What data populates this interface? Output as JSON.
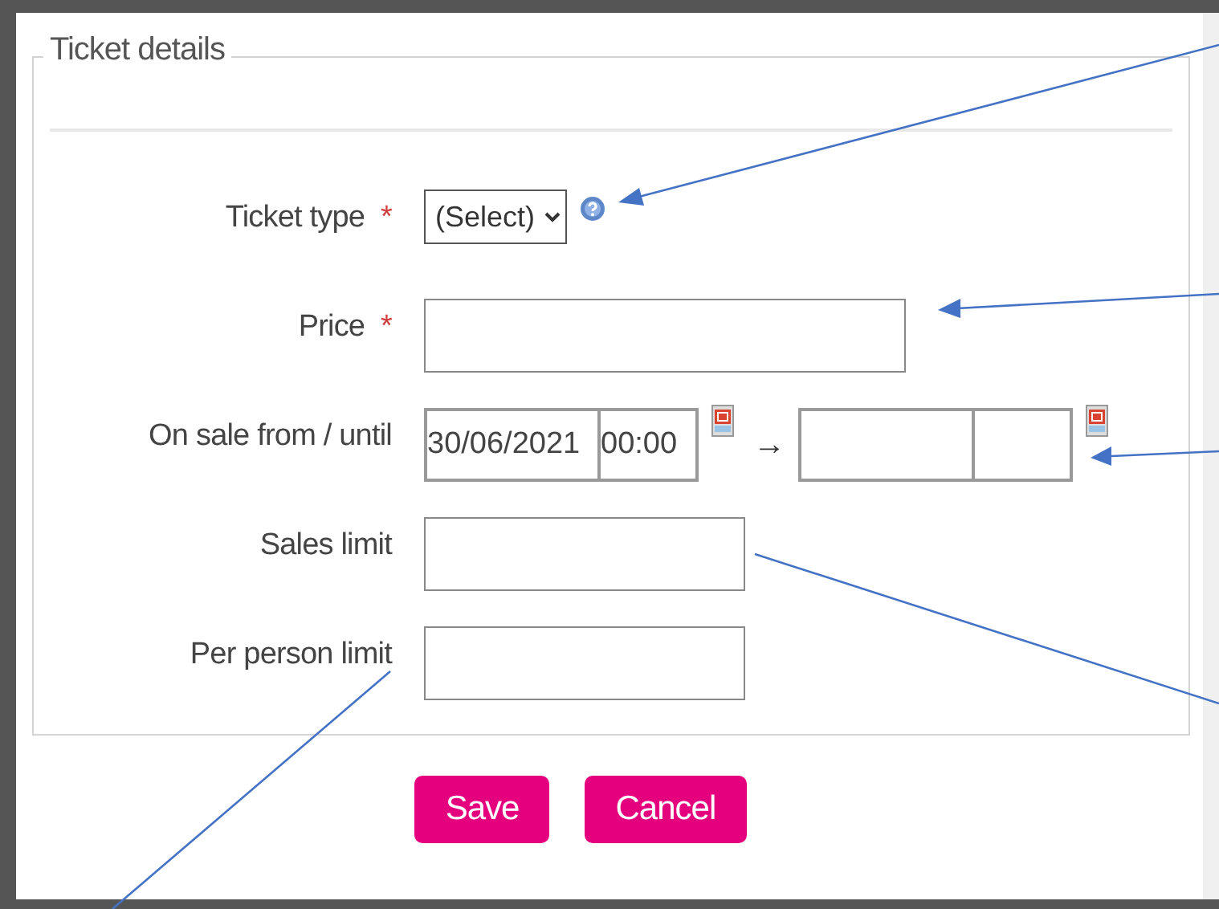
{
  "fieldset": {
    "legend": "Ticket details"
  },
  "fields": [
    {
      "kind": "select",
      "label": "Ticket type",
      "required_mark": "*",
      "value": "(Select)",
      "help": true
    },
    {
      "kind": "wide_text",
      "label": "Price",
      "required_mark": "*"
    },
    {
      "kind": "daterange",
      "label": "On sale from / until",
      "from_date": "30/06/2021",
      "from_time": "00:00",
      "separator": "→"
    },
    {
      "kind": "text",
      "label": "Sales limit"
    },
    {
      "kind": "text",
      "label": "Per person limit"
    }
  ],
  "buttons": [
    {
      "label": "Save"
    },
    {
      "label": "Cancel"
    }
  ]
}
